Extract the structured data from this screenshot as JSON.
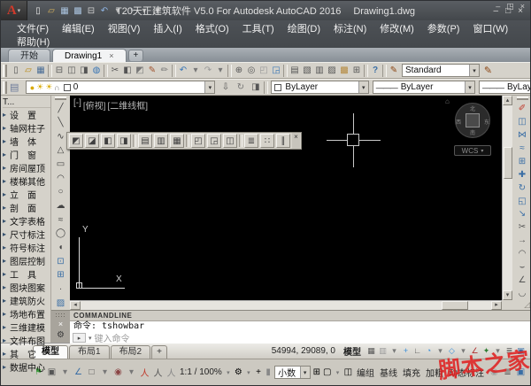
{
  "window": {
    "title": "T20天正建筑软件 V5.0 For Autodesk AutoCAD 2016",
    "doc": "Drawing1.dwg",
    "logo": "A",
    "logo_caret": "▾",
    "min": "–",
    "max": "□",
    "close": "×"
  },
  "qat": [
    {
      "name": "new-icon",
      "glyph": "▯",
      "color": "#e8e8e8"
    },
    {
      "name": "open-icon",
      "glyph": "▱",
      "color": "#d9b35c"
    },
    {
      "name": "save-icon",
      "glyph": "▦",
      "color": "#a9c2dd"
    },
    {
      "name": "saveas-icon",
      "glyph": "▩",
      "color": "#a9c2dd"
    },
    {
      "name": "plot-icon",
      "glyph": "⊟",
      "color": "#d0d0d0"
    },
    {
      "name": "undo-icon",
      "glyph": "↶",
      "color": "#8fb4e3"
    },
    {
      "name": "undo-caret-icon",
      "glyph": "▾",
      "color": "#bdbdbd"
    },
    {
      "name": "redo-icon",
      "glyph": "↷",
      "color": "#9a9fa4"
    },
    {
      "name": "redo-caret-icon",
      "glyph": "▾",
      "color": "#bdbdbd"
    },
    {
      "name": "qat-customize-icon",
      "glyph": "▾",
      "color": "#bdbdbd"
    }
  ],
  "menu": {
    "items": [
      {
        "label": "文件(F)",
        "name": "menu-file"
      },
      {
        "label": "编辑(E)",
        "name": "menu-edit"
      },
      {
        "label": "视图(V)",
        "name": "menu-view"
      },
      {
        "label": "插入(I)",
        "name": "menu-insert"
      },
      {
        "label": "格式(O)",
        "name": "menu-format"
      },
      {
        "label": "工具(T)",
        "name": "menu-tools"
      },
      {
        "label": "绘图(D)",
        "name": "menu-draw"
      },
      {
        "label": "标注(N)",
        "name": "menu-dimension"
      },
      {
        "label": "修改(M)",
        "name": "menu-modify"
      },
      {
        "label": "参数(P)",
        "name": "menu-parametric"
      },
      {
        "label": "窗口(W)",
        "name": "menu-window"
      }
    ],
    "help": "帮助(H)",
    "doc_min": "–",
    "doc_restore": "◳",
    "doc_close": "×"
  },
  "file_tabs": {
    "start": "开始",
    "doc": "Drawing1",
    "close": "×",
    "add": "+"
  },
  "toolbar1": {
    "icons": [
      {
        "name": "new-icon",
        "glyph": "▯",
        "color": "#555"
      },
      {
        "name": "open-icon",
        "glyph": "▱",
        "color": "#b8860b"
      },
      {
        "name": "save-icon",
        "glyph": "▦",
        "color": "#4a6d96"
      },
      {
        "name": "separator",
        "glyph": "",
        "cls": "sep",
        "ni": true
      },
      {
        "name": "plot-icon",
        "glyph": "⊟",
        "color": "#555"
      },
      {
        "name": "plot-preview-icon",
        "glyph": "◫",
        "color": "#555"
      },
      {
        "name": "publish-icon",
        "glyph": "◨",
        "color": "#555"
      },
      {
        "name": "etransmit-icon",
        "glyph": "◍",
        "color": "#3a76b5"
      },
      {
        "name": "separator",
        "glyph": "",
        "cls": "sep",
        "ni": true
      },
      {
        "name": "cut-icon",
        "glyph": "✂",
        "color": "#555"
      },
      {
        "name": "copy-icon",
        "glyph": "◧",
        "color": "#555"
      },
      {
        "name": "paste-icon",
        "glyph": "◩",
        "color": "#777"
      },
      {
        "name": "match-properties-icon",
        "glyph": "✎",
        "color": "#a0522d"
      },
      {
        "name": "edit-icon",
        "glyph": "✏",
        "color": "#777"
      },
      {
        "name": "separator",
        "glyph": "",
        "cls": "sep",
        "ni": true
      },
      {
        "name": "undo-icon",
        "glyph": "↶",
        "color": "#3a76b5"
      },
      {
        "name": "undo-caret-icon",
        "glyph": "▾",
        "color": "#777"
      },
      {
        "name": "redo-icon",
        "glyph": "↷",
        "color": "#999"
      },
      {
        "name": "redo-caret-icon",
        "glyph": "▾",
        "color": "#777"
      },
      {
        "name": "separator",
        "glyph": "",
        "cls": "sep",
        "ni": true
      },
      {
        "name": "pan-icon",
        "glyph": "⊕",
        "color": "#555"
      },
      {
        "name": "zoom-realtime-icon",
        "glyph": "◎",
        "color": "#555"
      },
      {
        "name": "zoom-window-icon",
        "glyph": "◰",
        "color": "#999"
      },
      {
        "name": "zoom-previous-icon",
        "glyph": "◲",
        "color": "#3a76b5"
      },
      {
        "name": "separator",
        "glyph": "",
        "cls": "sep",
        "ni": true
      },
      {
        "name": "properties-icon",
        "glyph": "▤",
        "color": "#555"
      },
      {
        "name": "designcenter-icon",
        "glyph": "▧",
        "color": "#555"
      },
      {
        "name": "tool-palettes-icon",
        "glyph": "▥",
        "color": "#555"
      },
      {
        "name": "sheet-set-manager-icon",
        "glyph": "▨",
        "color": "#555"
      },
      {
        "name": "markup-icon",
        "glyph": "▩",
        "color": "#b58a3f"
      },
      {
        "name": "quickcalc-icon",
        "glyph": "⊞",
        "color": "#555"
      },
      {
        "name": "separator",
        "glyph": "",
        "cls": "sep",
        "ni": true
      },
      {
        "name": "help-icon",
        "glyph": "?",
        "color": "#3a6ea5",
        "cls": "helpic"
      }
    ],
    "brush": "✎",
    "style_combo": "Standard",
    "caret": "▾"
  },
  "toolbar2": {
    "layer_manager_icon": "▤",
    "bulb": "●",
    "sun1": "☀",
    "sun2": "☀",
    "lock": "∩",
    "layer_name": "0",
    "buttons": [
      {
        "name": "make-object-layer-current-icon",
        "glyph": "⇩",
        "color": "#555"
      },
      {
        "name": "layer-previous-icon",
        "glyph": "↻",
        "color": "#777"
      },
      {
        "name": "layer-states-icon",
        "glyph": "◨",
        "color": "#555"
      }
    ],
    "color_value": "ByLayer",
    "linetype_value": "ByLayer",
    "lineweight_value": "ByLayer",
    "line_sample": "———",
    "caret": "▾"
  },
  "sidebar": {
    "header": "T...",
    "arrow": "▸",
    "items": [
      {
        "label": "设　置",
        "name": "sidebar-item-settings"
      },
      {
        "label": "轴网柱子",
        "name": "sidebar-item-axis-grid-column"
      },
      {
        "label": "墙　体",
        "name": "sidebar-item-wall"
      },
      {
        "label": "门　窗",
        "name": "sidebar-item-door-window"
      },
      {
        "label": "房间屋顶",
        "name": "sidebar-item-room-roof"
      },
      {
        "label": "楼梯其他",
        "name": "sidebar-item-stair-other"
      },
      {
        "label": "立　面",
        "name": "sidebar-item-elevation"
      },
      {
        "label": "剖　面",
        "name": "sidebar-item-section"
      },
      {
        "label": "文字表格",
        "name": "sidebar-item-text-table"
      },
      {
        "label": "尺寸标注",
        "name": "sidebar-item-dimension"
      },
      {
        "label": "符号标注",
        "name": "sidebar-item-symbol-annotation"
      },
      {
        "label": "图层控制",
        "name": "sidebar-item-layer-control"
      },
      {
        "label": "工　具",
        "name": "sidebar-item-tools"
      },
      {
        "label": "图块图案",
        "name": "sidebar-item-block-pattern"
      },
      {
        "label": "建筑防火",
        "name": "sidebar-item-fire-protection"
      },
      {
        "label": "场地布置",
        "name": "sidebar-item-site-layout"
      },
      {
        "label": "三维建模",
        "name": "sidebar-item-3d-modeling"
      },
      {
        "label": "文件布图",
        "name": "sidebar-item-file-layout"
      },
      {
        "label": "其　它",
        "name": "sidebar-item-others"
      },
      {
        "label": "数据中心",
        "name": "sidebar-item-data-center"
      }
    ]
  },
  "draw_toolbar": [
    {
      "name": "line-icon",
      "glyph": "╱",
      "color": "#444"
    },
    {
      "name": "construction-line-icon",
      "glyph": "╲",
      "color": "#444"
    },
    {
      "name": "polyline-icon",
      "glyph": "∿",
      "color": "#444"
    },
    {
      "name": "polygon-icon",
      "glyph": "△",
      "color": "#444"
    },
    {
      "name": "rectangle-icon",
      "glyph": "▭",
      "color": "#444"
    },
    {
      "name": "arc-icon",
      "glyph": "◠",
      "color": "#444"
    },
    {
      "name": "circle-icon",
      "glyph": "○",
      "color": "#444"
    },
    {
      "name": "revision-cloud-icon",
      "glyph": "☁",
      "color": "#444"
    },
    {
      "name": "spline-icon",
      "glyph": "≈",
      "color": "#444"
    },
    {
      "name": "ellipse-icon",
      "glyph": "◯",
      "color": "#444"
    },
    {
      "name": "ellipse-arc-icon",
      "glyph": "◖",
      "color": "#444"
    },
    {
      "name": "insert-block-icon",
      "glyph": "⊡",
      "color": "#3a6ea5"
    },
    {
      "name": "make-block-icon",
      "glyph": "⊞",
      "color": "#3a6ea5"
    },
    {
      "name": "point-icon",
      "glyph": "∙",
      "color": "#444"
    },
    {
      "name": "hatch-icon",
      "glyph": "▨",
      "color": "#3a6ea5"
    }
  ],
  "modify_toolbar": [
    {
      "name": "erase-icon",
      "glyph": "✐",
      "color": "#c0392b"
    },
    {
      "name": "copy-icon",
      "glyph": "◫",
      "color": "#3a6ea5"
    },
    {
      "name": "mirror-icon",
      "glyph": "⋈",
      "color": "#3a6ea5"
    },
    {
      "name": "offset-icon",
      "glyph": "≈",
      "color": "#3a6ea5"
    },
    {
      "name": "array-icon",
      "glyph": "⊞",
      "color": "#3a6ea5"
    },
    {
      "name": "move-icon",
      "glyph": "✚",
      "color": "#3a6ea5"
    },
    {
      "name": "rotate-icon",
      "glyph": "↻",
      "color": "#3a6ea5"
    },
    {
      "name": "scale-icon",
      "glyph": "◱",
      "color": "#3a6ea5"
    },
    {
      "name": "stretch-icon",
      "glyph": "↘",
      "color": "#3a6ea5"
    },
    {
      "name": "trim-icon",
      "glyph": "✂",
      "color": "#555"
    },
    {
      "name": "extend-icon",
      "glyph": "→",
      "color": "#555"
    },
    {
      "name": "break-at-point-icon",
      "glyph": "◠",
      "color": "#555"
    },
    {
      "name": "break-icon",
      "glyph": "⌣",
      "color": "#555"
    },
    {
      "name": "chamfer-icon",
      "glyph": "∠",
      "color": "#555"
    },
    {
      "name": "fillet-icon",
      "glyph": "◡",
      "color": "#555"
    }
  ],
  "canvas": {
    "vp_minus": "[-]",
    "vp_view": "[俯视]",
    "vp_style": "[二维线框]",
    "floating_toolbar": {
      "icons": [
        {
          "name": "bring-to-front-icon",
          "glyph": "◩"
        },
        {
          "name": "send-to-back-icon",
          "glyph": "◪"
        },
        {
          "name": "bring-above-icon",
          "glyph": "◧"
        },
        {
          "name": "send-under-icon",
          "glyph": "◨"
        },
        {
          "name": "separator",
          "glyph": "",
          "cls": "sep",
          "ni": true
        },
        {
          "name": "align-left-icon",
          "glyph": "▤"
        },
        {
          "name": "align-center-icon",
          "glyph": "▥"
        },
        {
          "name": "align-right-icon",
          "glyph": "▦"
        },
        {
          "name": "separator",
          "glyph": "",
          "cls": "sep",
          "ni": true
        },
        {
          "name": "distribute-horizontal-icon",
          "glyph": "◰"
        },
        {
          "name": "distribute-vertical-icon",
          "glyph": "◲"
        },
        {
          "name": "equal-spacing-icon",
          "glyph": "◫"
        },
        {
          "name": "separator",
          "glyph": "",
          "cls": "sep",
          "ni": true
        },
        {
          "name": "list-icon",
          "glyph": "≣"
        },
        {
          "name": "columns-icon",
          "glyph": "∷"
        },
        {
          "name": "parallel-icon",
          "glyph": "∥"
        }
      ],
      "close": "×"
    },
    "viewcube": {
      "home": "⌂",
      "n": "北",
      "e": "东",
      "s": "南",
      "w": "西",
      "wcs": "WCS",
      "caret": "▾"
    },
    "ucs": {
      "x": "X",
      "y": "Y"
    }
  },
  "scrollbars": {
    "up": "▴",
    "down": "▾",
    "left": "◂",
    "right": "▸",
    "corner": "◿"
  },
  "command": {
    "strip_close": "×",
    "strip_tool": "⚙",
    "title": "COMMANDLINE",
    "history": "命令: tshowbar",
    "prompt": "▸",
    "caret": "▾",
    "placeholder": "键入命令"
  },
  "layout_bar": {
    "tabs": [
      {
        "label": "模型",
        "name": "tab-model",
        "cls": "active"
      },
      {
        "label": "布局1",
        "name": "tab-layout1"
      },
      {
        "label": "布局2",
        "name": "tab-layout2"
      }
    ],
    "add": "+",
    "coords": "54994, 29089, 0",
    "model_label": "模型",
    "icons": [
      {
        "name": "grid-icon",
        "glyph": "▦",
        "color": "#555"
      },
      {
        "name": "snap-icon",
        "glyph": "▥",
        "color": "#999"
      },
      {
        "name": "snap-caret-icon",
        "glyph": "▾",
        "color": "#777"
      },
      {
        "name": "dynamic-input-icon",
        "glyph": "+",
        "color": "#3a8fd9"
      },
      {
        "name": "ortho-icon",
        "glyph": "∟",
        "color": "#555"
      },
      {
        "name": "polar-icon",
        "glyph": "◔",
        "color": "#3a8fd9"
      },
      {
        "name": "polar-caret-icon",
        "glyph": "▾",
        "color": "#777"
      },
      {
        "name": "osnap-icon",
        "glyph": "◇",
        "color": "#3a8fd9"
      },
      {
        "name": "osnap-caret-icon",
        "glyph": "▾",
        "color": "#777"
      },
      {
        "name": "otrack-icon",
        "glyph": "∠",
        "color": "#b03030"
      },
      {
        "name": "annotation-visibility-icon",
        "glyph": "✦",
        "color": "#2e7d32"
      },
      {
        "name": "annotation-caret-icon",
        "glyph": "▾",
        "color": "#777"
      },
      {
        "name": "lineweight-icon",
        "glyph": "≣",
        "color": "#555"
      },
      {
        "name": "annotation-monitor-icon",
        "glyph": "▣",
        "color": "#3a6ea5"
      }
    ]
  },
  "status_bar": {
    "left_icons": [
      {
        "name": "green-flag-icon",
        "glyph": "⚑",
        "color": "#3f9d3f"
      },
      {
        "name": "cube-icon",
        "glyph": "▣",
        "color": "#555"
      },
      {
        "name": "cube-caret-icon",
        "glyph": "▾",
        "color": "#777"
      },
      {
        "name": "axes-icon",
        "glyph": "∠",
        "color": "#3a6ea5"
      },
      {
        "name": "box-icon",
        "glyph": "□",
        "color": "#555"
      },
      {
        "name": "box-caret-icon",
        "glyph": "▾",
        "color": "#777"
      },
      {
        "name": "steering-wheel-icon",
        "glyph": "◉",
        "color": "#8a4444"
      },
      {
        "name": "wheel-caret-icon",
        "glyph": "▾",
        "color": "#777"
      },
      {
        "name": "annotation-runner-red-icon",
        "glyph": "人",
        "color": "#c0392b"
      },
      {
        "name": "annotation-runner-icon",
        "glyph": "人",
        "color": "#555"
      },
      {
        "name": "annotation-runner-gray-icon",
        "glyph": "人",
        "color": "#888"
      }
    ],
    "scale": "1:1 / 100%",
    "scale_caret": "▾",
    "gear": "⚙",
    "gear_caret": "▾",
    "plus": "+",
    "ruler": "▮",
    "units": "小数",
    "units_caret": "▾",
    "calc": "⊞",
    "display": "▢",
    "display_caret": "▾",
    "group_icon": "◫",
    "toggles": [
      {
        "label": "编组",
        "name": "toggle-group"
      },
      {
        "label": "基线",
        "name": "toggle-baseline"
      },
      {
        "label": "填充",
        "name": "toggle-fill"
      },
      {
        "label": "加粗",
        "name": "toggle-bold-line"
      },
      {
        "label": "动态标注",
        "name": "toggle-dynamic-dimension"
      }
    ],
    "right_icons": [
      {
        "name": "lock-icon",
        "glyph": "◉",
        "color": "#999"
      },
      {
        "name": "list-icon",
        "glyph": "≣",
        "color": "#555"
      },
      {
        "name": "clean-screen-icon",
        "glyph": "▣",
        "color": "#3a6ea5"
      }
    ]
  },
  "watermark": "脚本之家",
  "colors": {
    "canvas_bg": "#000000",
    "titlebar": "#44484d",
    "toolbar_bg": "#d5d2ca",
    "watermark_red": "#e02222",
    "accent_blue": "#3a6ea5"
  }
}
